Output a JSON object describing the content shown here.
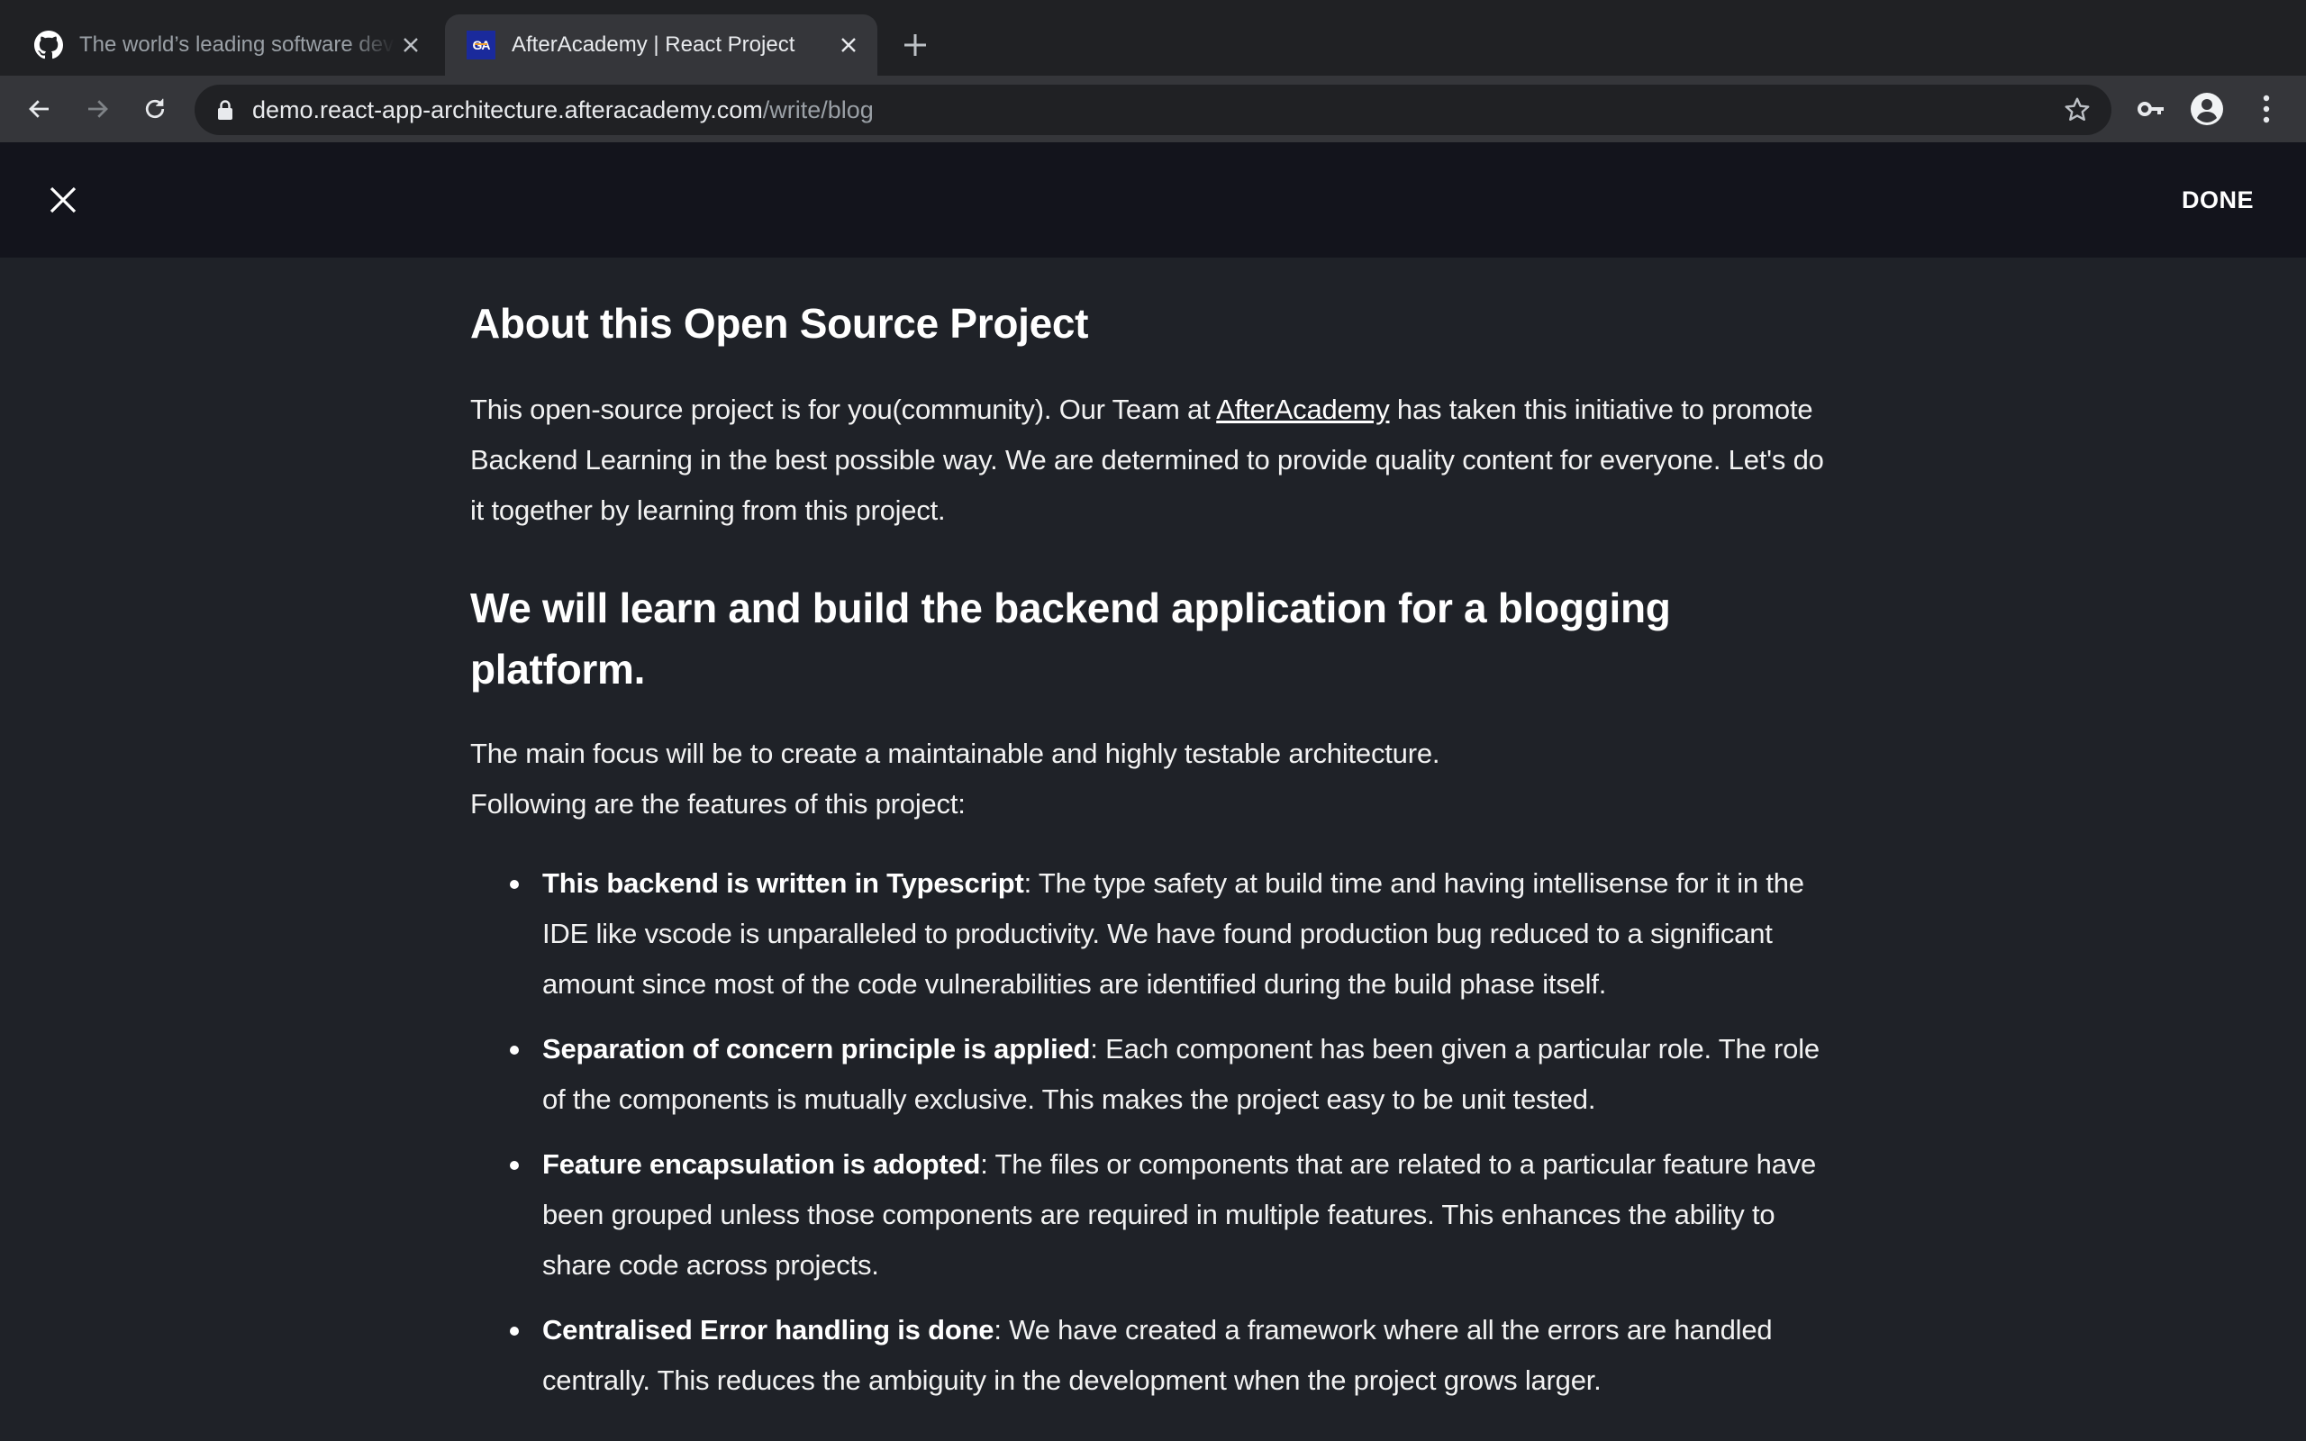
{
  "browser": {
    "tabs": [
      {
        "title": "The world’s leading software development platform",
        "favicon": "github-icon",
        "active": false
      },
      {
        "title": "AfterAcademy | React Project",
        "favicon": "afteracademy-icon",
        "favicon_text": "GA",
        "active": true
      }
    ],
    "url": {
      "host": "demo.react-app-architecture.afteracademy.com",
      "path": "/write/blog"
    }
  },
  "header": {
    "close_icon": "close-icon",
    "done_label": "DONE"
  },
  "article": {
    "section1_title": "About this Open Source Project",
    "intro": {
      "before_link": "This open-source project is for you(community). Our Team at ",
      "link_text": "AfterAcademy",
      "after_link": " has taken this initiative to promote Backend Learning in the best possible way. We are determined to provide quality content for everyone. Let's do it together by learning from this project."
    },
    "section2_title": "We will learn and build the backend application for a blogging platform.",
    "focus_line1": "The main focus will be to create a maintainable and highly testable architecture.",
    "focus_line2": "Following are the features of this project:",
    "features": [
      {
        "title": "This backend is written in Typescript",
        "text": ": The type safety at build time and having intellisense for it in the IDE like vscode is unparalleled to productivity. We have found production bug reduced to a significant amount since most of the code vulnerabilities are identified during the build phase itself."
      },
      {
        "title": "Separation of concern principle is applied",
        "text": ": Each component has been given a particular role. The role of the components is mutually exclusive. This makes the project easy to be unit tested."
      },
      {
        "title": "Feature encapsulation is adopted",
        "text": ": The files or components that are related to a particular feature have been grouped unless those components are required in multiple features. This enhances the ability to share code across projects."
      },
      {
        "title": "Centralised Error handling is done",
        "text": ": We have created a framework where all the errors are handled centrally. This reduces the ambiguity in the development when the project grows larger."
      }
    ]
  },
  "colors": {
    "tabstrip_bg": "#202124",
    "toolbar_bg": "#35363a",
    "app_header_bg": "#13141c",
    "page_bg": "#1f2228",
    "favicon_brand": "#1a2a9c"
  }
}
